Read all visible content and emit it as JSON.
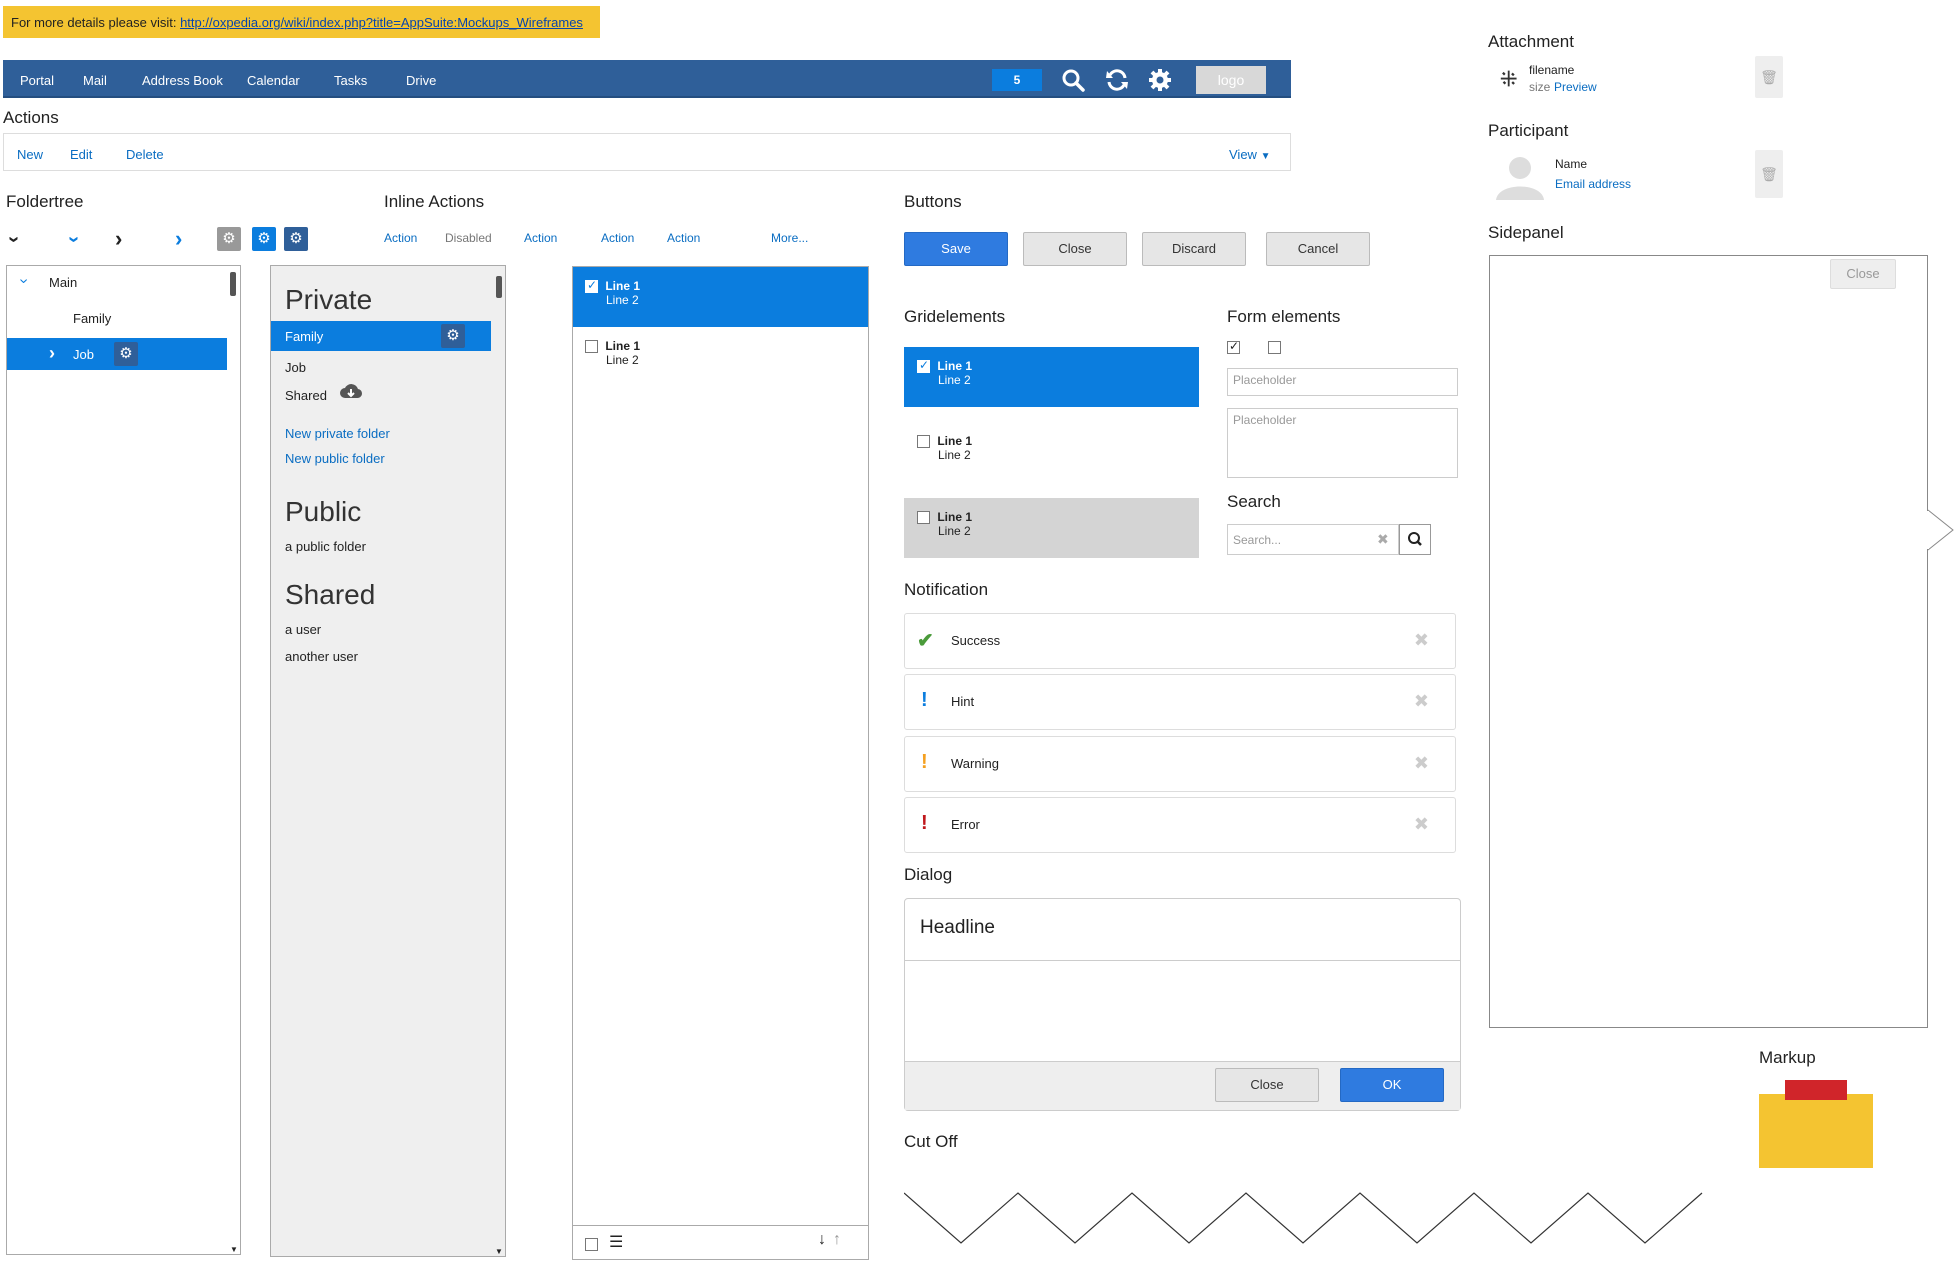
{
  "infobar": {
    "prefix": "For more details please visit:",
    "url": "http://oxpedia.org/wiki/index.php?title=AppSuite:Mockups_Wireframes"
  },
  "topbar": {
    "nav": [
      "Portal",
      "Mail",
      "Address Book",
      "Calendar",
      "Tasks",
      "Drive"
    ],
    "badge": "5",
    "logo": "logo"
  },
  "actions": {
    "heading": "Actions",
    "items": [
      "New",
      "Edit",
      "Delete"
    ],
    "view": "View"
  },
  "foldertree": {
    "heading": "Foldertree",
    "main": "Main",
    "family": "Family",
    "job": "Job"
  },
  "inline_actions": {
    "heading": "Inline Actions",
    "items": [
      "Action",
      "Disabled",
      "Action",
      "Action",
      "Action"
    ],
    "more": "More..."
  },
  "folders": {
    "private": {
      "title": "Private",
      "items": [
        "Family",
        "Job",
        "Shared"
      ],
      "links": [
        "New private folder",
        "New public folder"
      ]
    },
    "public": {
      "title": "Public",
      "items": [
        "a public folder"
      ]
    },
    "shared": {
      "title": "Shared",
      "items": [
        "a user",
        "another user"
      ]
    }
  },
  "list": {
    "line1": "Line 1",
    "line2": "Line 2"
  },
  "buttons": {
    "heading": "Buttons",
    "save": "Save",
    "close": "Close",
    "discard": "Discard",
    "cancel": "Cancel"
  },
  "gridelements": {
    "heading": "Gridelements",
    "line1": "Line 1",
    "line2": "Line 2"
  },
  "form": {
    "heading": "Form elements",
    "placeholder1": "Placeholder",
    "placeholder2": "Placeholder"
  },
  "search": {
    "heading": "Search",
    "placeholder": "Search..."
  },
  "notification": {
    "heading": "Notification",
    "items": [
      "Success",
      "Hint",
      "Warning",
      "Error"
    ]
  },
  "dialog": {
    "heading": "Dialog",
    "headline": "Headline",
    "close": "Close",
    "ok": "OK"
  },
  "cutoff": {
    "heading": "Cut Off"
  },
  "attachment": {
    "heading": "Attachment",
    "filename": "filename",
    "size": "size",
    "preview": "Preview"
  },
  "participant": {
    "heading": "Participant",
    "name": "Name",
    "email": "Email address"
  },
  "sidepanel": {
    "heading": "Sidepanel",
    "close": "Close"
  },
  "markup": {
    "heading": "Markup"
  },
  "colors": {
    "primary": "#2f5f99",
    "accent": "#0b7dde",
    "success": "#4a9b3a",
    "hint": "#0b7dde",
    "warning": "#f4a020",
    "error": "#c0181c"
  }
}
